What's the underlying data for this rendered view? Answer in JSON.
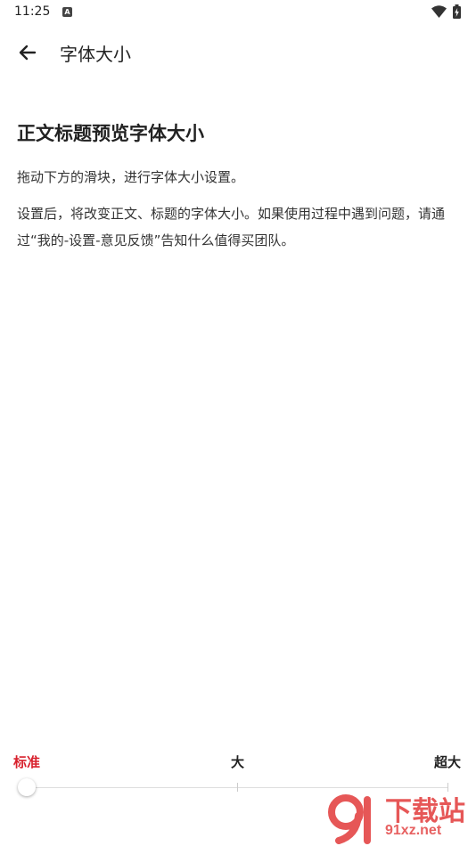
{
  "status_bar": {
    "time": "11:25",
    "notification_icon": "a-icon",
    "wifi_icon": "wifi-icon",
    "battery_icon": "battery-charging-icon"
  },
  "app_bar": {
    "back_icon": "arrow-left-icon",
    "title": "字体大小"
  },
  "preview": {
    "title": "正文标题预览字体大小",
    "paragraph_1": "拖动下方的滑块，进行字体大小设置。",
    "paragraph_2": "设置后，将改变正文、标题的字体大小。如果使用过程中遇到问题，请通过“我的-设置-意见反馈”告知什么值得买团队。"
  },
  "slider": {
    "labels": [
      "标准",
      "大",
      "超大"
    ],
    "selected": "标准",
    "selected_index": 0,
    "active_color": "#d8212d"
  },
  "watermark": {
    "text_cn": "下载站",
    "text_en": "91xz.net"
  }
}
